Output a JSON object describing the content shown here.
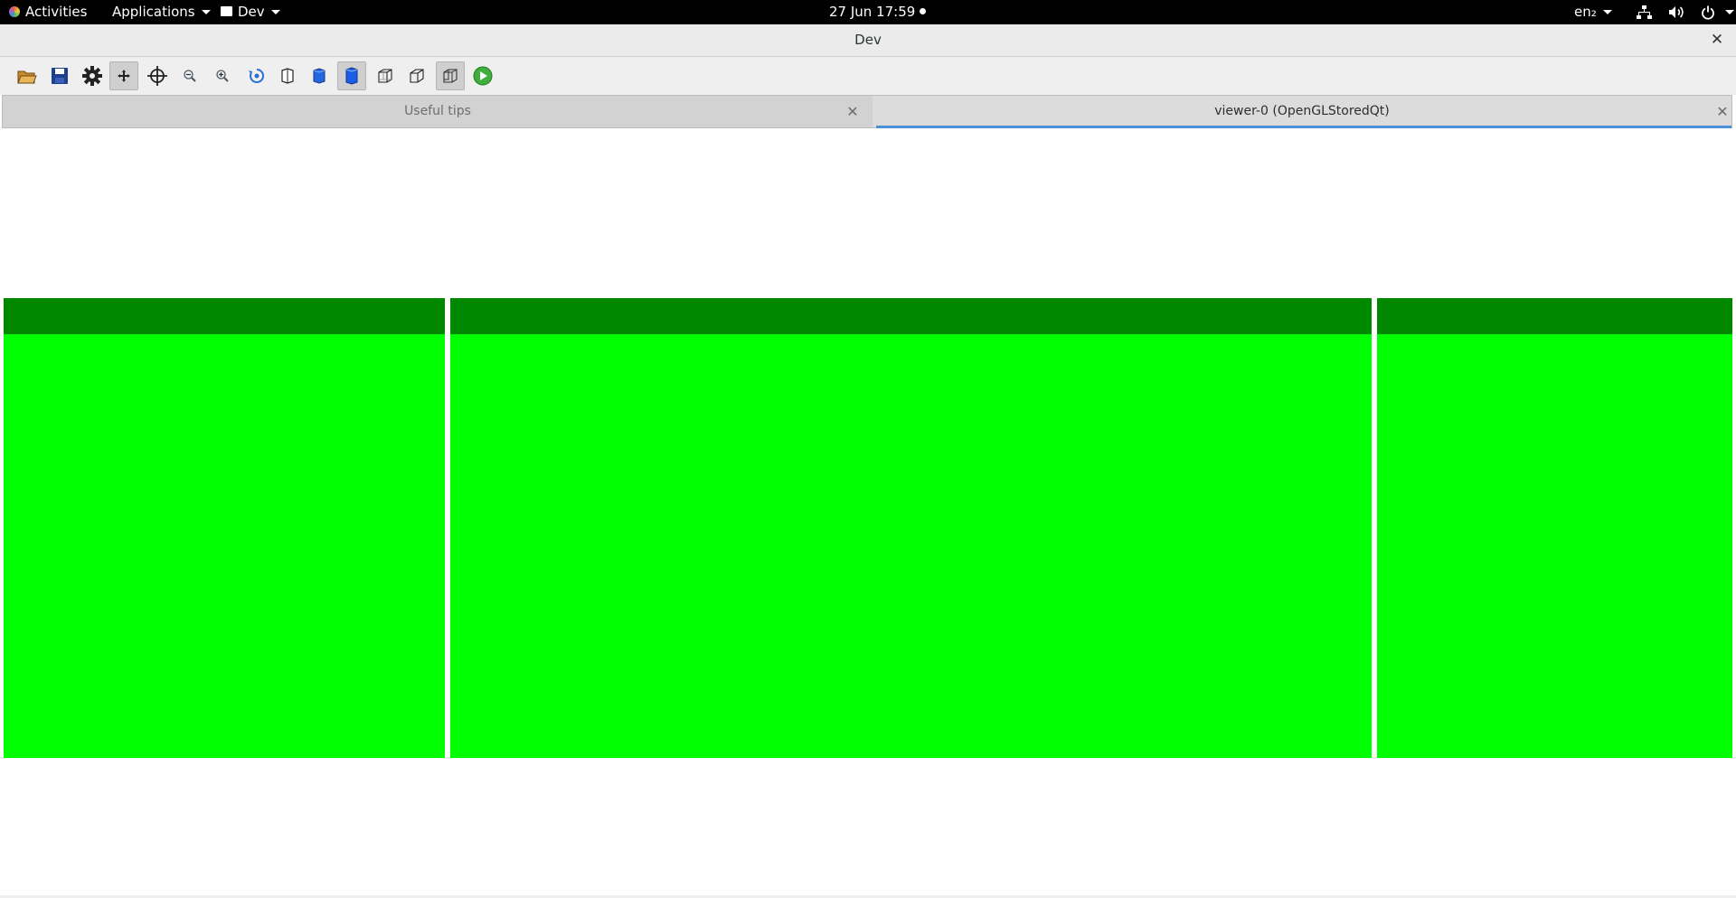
{
  "topbar": {
    "activities": "Activities",
    "applications": "Applications",
    "app_menu": "Dev",
    "clock": "27 Jun  17:59",
    "input_source": "en₂"
  },
  "window": {
    "title": "Dev",
    "close_glyph": "✕"
  },
  "toolbar": {
    "buttons": [
      {
        "icon": "open-folder-icon",
        "checked": false
      },
      {
        "icon": "save-icon",
        "checked": false
      },
      {
        "icon": "settings-gear-icon",
        "checked": false
      },
      {
        "icon": "move-icon",
        "checked": true
      },
      {
        "icon": "pick-crosshair-icon",
        "checked": false
      },
      {
        "icon": "zoom-out-icon",
        "checked": false
      },
      {
        "icon": "zoom-in-icon",
        "checked": false
      },
      {
        "icon": "rotate-icon",
        "checked": false
      },
      {
        "icon": "hidden-line-icon",
        "checked": false
      },
      {
        "icon": "solid-surface-icon",
        "checked": false
      },
      {
        "icon": "solid-surface-selected-icon",
        "checked": true
      },
      {
        "icon": "wireframe-icon",
        "checked": false
      },
      {
        "icon": "perspective-icon",
        "checked": false
      },
      {
        "icon": "ortho-icon",
        "checked": true
      },
      {
        "icon": "run-icon",
        "checked": false
      }
    ]
  },
  "tabs": [
    {
      "label": "Useful tips",
      "active": false,
      "close_glyph": "✕"
    },
    {
      "label": "viewer-0 (OpenGLStoredQt)",
      "active": true,
      "close_glyph": "✕"
    }
  ],
  "colors": {
    "panel_fill": "#00ff00",
    "panel_top": "#008800",
    "tab_active_indicator": "#4a90d9"
  }
}
